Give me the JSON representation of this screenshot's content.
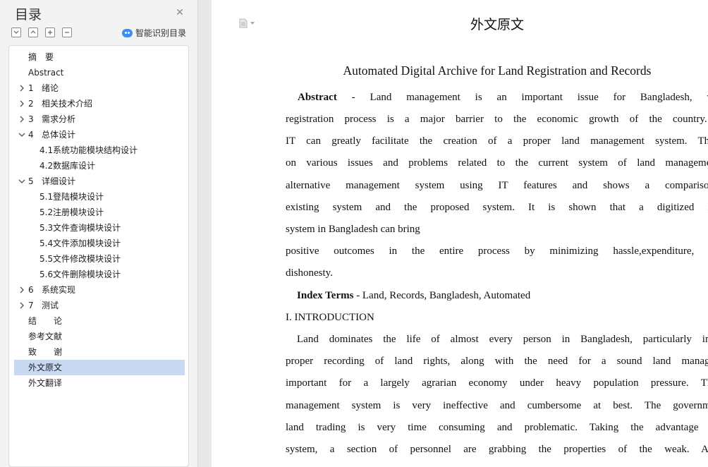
{
  "sidebar": {
    "title": "目录",
    "smart_label": "智能识别目录",
    "toc": [
      {
        "num": "",
        "label": "摘　要",
        "level": 0,
        "arrow": "none"
      },
      {
        "num": "",
        "label": "Abstract",
        "level": 0,
        "arrow": "none"
      },
      {
        "num": "1",
        "label": "绪论",
        "level": 0,
        "arrow": "right"
      },
      {
        "num": "2",
        "label": "相关技术介绍",
        "level": 0,
        "arrow": "right"
      },
      {
        "num": "3",
        "label": "需求分析",
        "level": 0,
        "arrow": "right"
      },
      {
        "num": "4",
        "label": "总体设计",
        "level": 0,
        "arrow": "down"
      },
      {
        "num": "4.1",
        "label": "系统功能模块结构设计",
        "level": 1,
        "arrow": "none"
      },
      {
        "num": "4.2",
        "label": "数据库设计",
        "level": 1,
        "arrow": "none"
      },
      {
        "num": "5",
        "label": "详细设计",
        "level": 0,
        "arrow": "down"
      },
      {
        "num": "5.1",
        "label": "登陆模块设计",
        "level": 1,
        "arrow": "none"
      },
      {
        "num": "5.2",
        "label": "注册模块设计",
        "level": 1,
        "arrow": "none"
      },
      {
        "num": "5.3",
        "label": "文件查询模块设计",
        "level": 1,
        "arrow": "none"
      },
      {
        "num": "5.4",
        "label": "文件添加模块设计",
        "level": 1,
        "arrow": "none"
      },
      {
        "num": "5.5",
        "label": "文件修改模块设计",
        "level": 1,
        "arrow": "none"
      },
      {
        "num": "5.6",
        "label": "文件删除模块设计",
        "level": 1,
        "arrow": "none"
      },
      {
        "num": "6",
        "label": "系统实现",
        "level": 0,
        "arrow": "right"
      },
      {
        "num": "7",
        "label": "测试",
        "level": 0,
        "arrow": "right"
      },
      {
        "num": "",
        "label": "结　　论",
        "level": 0,
        "arrow": "none"
      },
      {
        "num": "",
        "label": "参考文献",
        "level": 0,
        "arrow": "none"
      },
      {
        "num": "",
        "label": "致　　谢",
        "level": 0,
        "arrow": "none"
      },
      {
        "num": "",
        "label": "外文原文",
        "level": 0,
        "arrow": "none",
        "active": true
      },
      {
        "num": "",
        "label": "外文翻译",
        "level": 0,
        "arrow": "none"
      }
    ]
  },
  "document": {
    "heading": "外文原文",
    "paper_title": "Automated Digital Archive for Land Registration and Records",
    "abstract_label": "Abstract",
    "abstract_first": " - Land management is an important issue for Bangladesh, where the land",
    "abstract_lines": [
      "registration process is a major barrier to the economic growth of the country. Technology and",
      "IT can greatly facilitate the creation of a proper land management system. This paper focuses",
      "on various issues and problems related to the current system of land management. It offers an",
      "alternative management system using IT features and shows a comparison between the",
      "existing system and the proposed system. It is shown that a digitized land management",
      "system in Bangladesh can bring",
      "positive outcomes in the entire process by minimizing hassle,expenditure, time, and staff",
      "dishonesty."
    ],
    "index_label": "Index Terms",
    "index_text": " - Land, Records, Bangladesh, Automated",
    "section_heading": "I. INTRODUCTION",
    "intro_lines": [
      "Land dominates the life of almost every person in Bangladesh, particularly in rural areas. A",
      "proper recording of land rights, along with the need for a sound land management system is",
      "important for a largely agrarian economy under heavy population pressure. The existing land",
      "management system is very ineffective and cumbersome at best. The governmental system of",
      "land trading is very time consuming and problematic. Taking the advantage of this intricate",
      "system, a section of personnel are grabbing the properties of the weak. As a result, the"
    ]
  }
}
